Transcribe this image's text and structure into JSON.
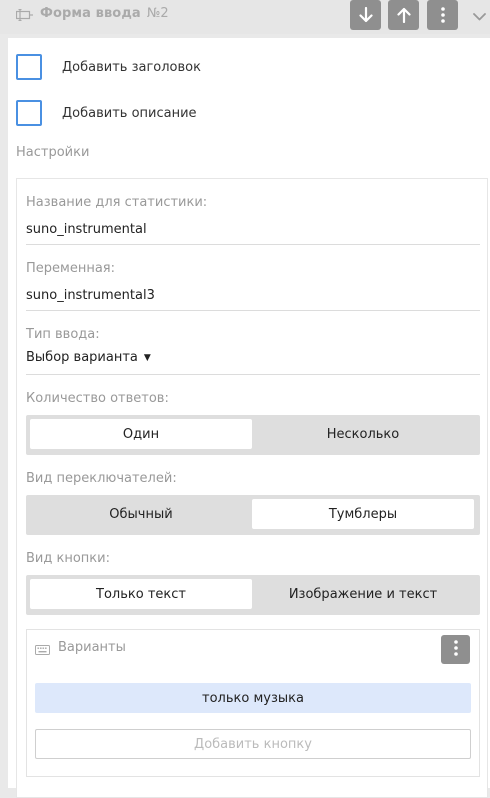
{
  "header": {
    "title": "Форма ввода",
    "number": "№2",
    "icons": [
      "input-form-icon",
      "arrow-down-icon",
      "arrow-up-icon",
      "more-vertical-icon",
      "chevron-down-icon"
    ]
  },
  "options": {
    "add_title_label": "Добавить заголовок",
    "add_description_label": "Добавить описание"
  },
  "settings": {
    "title": "Настройки",
    "stat_name_label": "Название для статистики:",
    "stat_name_value": "suno_instrumental",
    "variable_label": "Переменная:",
    "variable_value": "suno_instrumental3",
    "input_type_label": "Тип ввода:",
    "input_type_value": "Выбор варианта",
    "answers_count": {
      "label": "Количество ответов:",
      "options": [
        "Один",
        "Несколько"
      ],
      "selected": "Один"
    },
    "switch_view": {
      "label": "Вид переключателей:",
      "options": [
        "Обычный",
        "Тумблеры"
      ],
      "selected": "Тумблеры"
    },
    "button_view": {
      "label": "Вид кнопки:",
      "options": [
        "Только текст",
        "Изображение и текст"
      ],
      "selected": "Только текст"
    }
  },
  "variants": {
    "title": "Варианты",
    "items": [
      "только музыка"
    ],
    "add_button_label": "Добавить кнопку"
  },
  "colors": {
    "accent": "#4a90e2",
    "variant_bg": "#dde8fb",
    "icon_button": "#8f8f8f"
  }
}
